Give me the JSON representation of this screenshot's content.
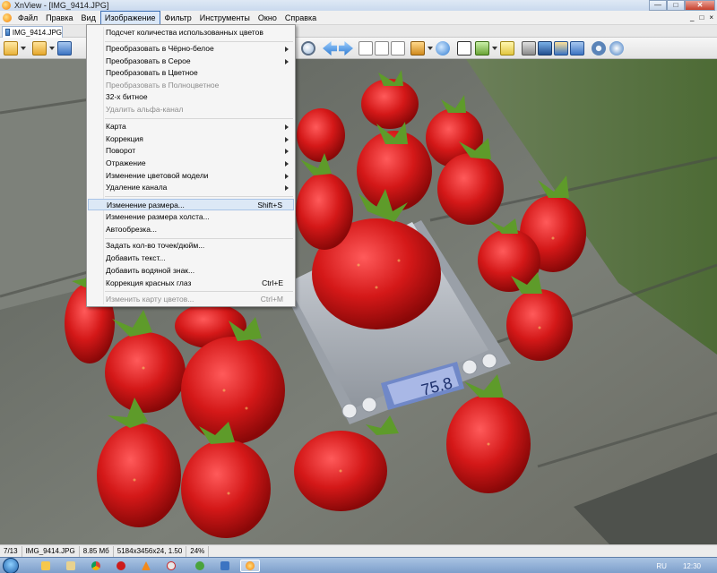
{
  "window": {
    "title": "XnView - [IMG_9414.JPG]",
    "controls": [
      "—",
      "□",
      "✕"
    ]
  },
  "menubar": {
    "items": [
      "Файл",
      "Правка",
      "Вид",
      "Изображение",
      "Фильтр",
      "Инструменты",
      "Окно",
      "Справка"
    ],
    "active_index": 3,
    "mdi_controls": [
      "_",
      "□",
      "×"
    ]
  },
  "tab": {
    "label": "IMG_9414.JPG"
  },
  "toolbar": {
    "icons": [
      "browse-icon",
      "open-icon",
      "save-icon",
      "zoom-out-icon",
      "previous-icon",
      "next-icon",
      "fit-icon",
      "fullscreen-icon",
      "slideshow-icon",
      "resize-icon",
      "rotate-icon",
      "compare-icon",
      "print-icon",
      "scan-icon",
      "capture-icon",
      "screenshot-icon",
      "settings-icon",
      "info-icon"
    ]
  },
  "dropdown": {
    "items": [
      {
        "label": "Подсчет количества использованных цветов",
        "disabled": false,
        "submenu": false,
        "shortcut": ""
      },
      {
        "sep": true
      },
      {
        "label": "Преобразовать в Чёрно-белое",
        "disabled": false,
        "submenu": true,
        "shortcut": ""
      },
      {
        "label": "Преобразовать в Серое",
        "disabled": false,
        "submenu": true,
        "shortcut": ""
      },
      {
        "label": "Преобразовать в Цветное",
        "disabled": false,
        "submenu": false,
        "shortcut": ""
      },
      {
        "label": "Преобразовать в Полноцветное",
        "disabled": true,
        "submenu": false,
        "shortcut": ""
      },
      {
        "label": "32-х битное",
        "disabled": false,
        "submenu": false,
        "shortcut": ""
      },
      {
        "label": "Удалить альфа-канал",
        "disabled": true,
        "submenu": false,
        "shortcut": ""
      },
      {
        "sep": true
      },
      {
        "label": "Карта",
        "disabled": false,
        "submenu": true,
        "shortcut": ""
      },
      {
        "label": "Коррекция",
        "disabled": false,
        "submenu": true,
        "shortcut": ""
      },
      {
        "label": "Поворот",
        "disabled": false,
        "submenu": true,
        "shortcut": ""
      },
      {
        "label": "Отражение",
        "disabled": false,
        "submenu": true,
        "shortcut": ""
      },
      {
        "label": "Изменение цветовой модели",
        "disabled": false,
        "submenu": true,
        "shortcut": ""
      },
      {
        "label": "Удаление канала",
        "disabled": false,
        "submenu": true,
        "shortcut": ""
      },
      {
        "sep": true
      },
      {
        "label": "Изменение размера...",
        "disabled": false,
        "submenu": false,
        "shortcut": "Shift+S",
        "highlight": true
      },
      {
        "label": "Изменение размера холста...",
        "disabled": false,
        "submenu": false,
        "shortcut": ""
      },
      {
        "label": "Автообрезка...",
        "disabled": false,
        "submenu": false,
        "shortcut": ""
      },
      {
        "sep": true
      },
      {
        "label": "Задать кол-во точек/дюйм...",
        "disabled": false,
        "submenu": false,
        "shortcut": ""
      },
      {
        "label": "Добавить текст...",
        "disabled": false,
        "submenu": false,
        "shortcut": ""
      },
      {
        "label": "Добавить водяной знак...",
        "disabled": false,
        "submenu": false,
        "shortcut": ""
      },
      {
        "label": "Коррекция красных глаз",
        "disabled": false,
        "submenu": false,
        "shortcut": "Ctrl+E"
      },
      {
        "sep": true
      },
      {
        "label": "Изменить карту цветов...",
        "disabled": true,
        "submenu": false,
        "shortcut": "Ctrl+M"
      }
    ]
  },
  "photo": {
    "scale_display": "75.8"
  },
  "statusbar": {
    "cells": [
      "7/13",
      "IMG_9414.JPG",
      "8.85 Мб",
      "5184x3456x24, 1.50",
      "24%"
    ]
  },
  "taskbar": {
    "apps": [
      "explorer",
      "files",
      "chrome",
      "opera",
      "vlc",
      "yandex",
      "utorrent",
      "save",
      "xnview"
    ],
    "active_index": 8,
    "lang": "RU",
    "time": "12:30"
  },
  "colors": {
    "menu_highlight": "#dce8f6",
    "titlebar": "#c9d9ee",
    "taskbar": "#8fb0d8"
  }
}
